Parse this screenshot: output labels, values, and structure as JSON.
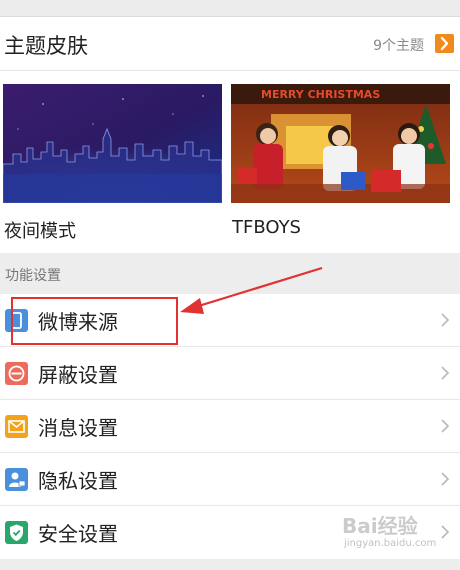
{
  "theme": {
    "title": "主题皮肤",
    "count": "9个主题",
    "items": [
      {
        "label": "夜间模式"
      },
      {
        "label": "TFBOYS"
      }
    ],
    "xmas_banner": "MERRY CHRISTMAS"
  },
  "functions": {
    "section_label": "功能设置",
    "items": [
      {
        "label": "微博来源",
        "icon": "phone-icon",
        "color": "#4a8fdc"
      },
      {
        "label": "屏蔽设置",
        "icon": "block-icon",
        "color": "#ee6a5a"
      },
      {
        "label": "消息设置",
        "icon": "mail-icon",
        "color": "#f2a31b"
      },
      {
        "label": "隐私设置",
        "icon": "user-lock-icon",
        "color": "#4a8fdc"
      },
      {
        "label": "安全设置",
        "icon": "shield-icon",
        "color": "#28a66b"
      }
    ]
  },
  "watermark": {
    "brand": "Bai经验",
    "url": "jingyan.baidu.com"
  },
  "colors": {
    "accent_orange": "#f08a1c",
    "annotation_red": "#e23131"
  }
}
